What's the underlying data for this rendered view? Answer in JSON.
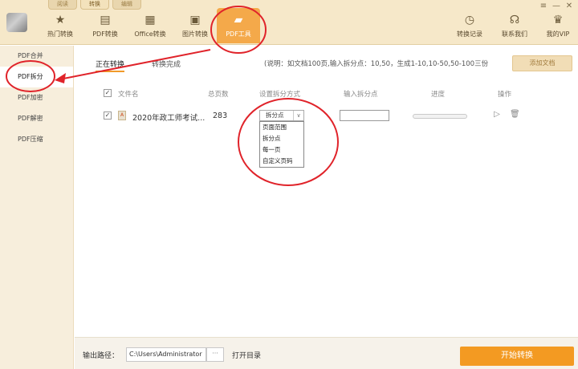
{
  "mode_tabs": [
    "阅读",
    "转换",
    "编辑"
  ],
  "toolbar": {
    "left": [
      {
        "label": "热门转换",
        "icon": "star-icon"
      },
      {
        "label": "PDF转换",
        "icon": "pdf-icon"
      },
      {
        "label": "Office转换",
        "icon": "document-icon"
      },
      {
        "label": "图片转换",
        "icon": "image-icon"
      },
      {
        "label": "PDF工具",
        "icon": "toolbox-icon"
      }
    ],
    "right": [
      {
        "label": "转换记录",
        "icon": "clock-icon"
      },
      {
        "label": "联系我们",
        "icon": "headset-icon"
      },
      {
        "label": "我的VIP",
        "icon": "crown-icon"
      }
    ]
  },
  "window_controls": [
    "≡",
    "—",
    "✕"
  ],
  "sidebar": {
    "items": [
      "PDF合并",
      "PDF拆分",
      "PDF加密",
      "PDF解密",
      "PDF压缩"
    ],
    "active": "PDF拆分"
  },
  "main": {
    "tabs": [
      "正在转换",
      "转换完成"
    ],
    "note": "(说明：如文档100页,输入拆分点：10,50，生成1-10,10-50,50-100三份",
    "add_button": "添加文档",
    "columns": [
      "文件名",
      "总页数",
      "设置拆分方式",
      "输入拆分点",
      "进度",
      "操作"
    ],
    "row": {
      "checked": true,
      "filename": "2020年政工师考试...",
      "pages": "283",
      "split_mode": "拆分点",
      "split_point": "",
      "progress": 0
    },
    "split_options": [
      "页面范围",
      "拆分点",
      "每一页",
      "自定义页码"
    ]
  },
  "footer": {
    "path_label": "输出路径：",
    "path_value": "C:\\Users\\Administrator",
    "path_more": "···",
    "open_dir": "打开目录",
    "start_button": "开始转换"
  },
  "colors": {
    "accent": "#f39a22",
    "annotation": "#e0232a",
    "toolbar_bg": "#f6e8c9"
  }
}
